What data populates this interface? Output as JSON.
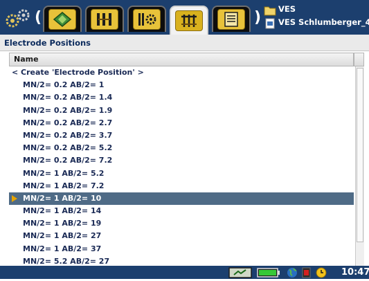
{
  "toolbar": {
    "tabs": [
      {
        "name": "tab-layout",
        "icon": "layout-diamond-icon",
        "active": false
      },
      {
        "name": "tab-electrodes",
        "icon": "electrode-array-icon",
        "active": false
      },
      {
        "name": "tab-settings",
        "icon": "electrode-gear-icon",
        "active": false
      },
      {
        "name": "tab-positions",
        "icon": "electrode-position-icon",
        "active": true
      },
      {
        "name": "tab-notes",
        "icon": "notepad-icon",
        "active": false
      }
    ],
    "breadcrumb": {
      "folder": "VES",
      "file": "VES Schlumberger_4"
    }
  },
  "section": {
    "title": "Electrode Positions"
  },
  "list": {
    "column_header": "Name",
    "create_item": "< Create 'Electrode Position' >",
    "items": [
      {
        "label": "MN/2= 0.2 AB/2= 1",
        "selected": false
      },
      {
        "label": "MN/2= 0.2 AB/2= 1.4",
        "selected": false
      },
      {
        "label": "MN/2= 0.2 AB/2= 1.9",
        "selected": false
      },
      {
        "label": "MN/2= 0.2 AB/2= 2.7",
        "selected": false
      },
      {
        "label": "MN/2= 0.2 AB/2= 3.7",
        "selected": false
      },
      {
        "label": "MN/2= 0.2 AB/2= 5.2",
        "selected": false
      },
      {
        "label": "MN/2= 0.2 AB/2= 7.2",
        "selected": false
      },
      {
        "label": "MN/2= 1 AB/2= 5.2",
        "selected": false
      },
      {
        "label": "MN/2= 1 AB/2= 7.2",
        "selected": false
      },
      {
        "label": "MN/2= 1 AB/2= 10",
        "selected": true
      },
      {
        "label": "MN/2= 1 AB/2= 14",
        "selected": false
      },
      {
        "label": "MN/2= 1 AB/2= 19",
        "selected": false
      },
      {
        "label": "MN/2= 1 AB/2= 27",
        "selected": false
      },
      {
        "label": "MN/2= 1 AB/2= 37",
        "selected": false
      },
      {
        "label": "MN/2= 5.2 AB/2= 27",
        "selected": false
      }
    ]
  },
  "statusbar": {
    "clock": "10:47",
    "icons": [
      "instrument-icon",
      "battery-icon",
      "globe-icon",
      "record-icon",
      "clock-icon"
    ]
  },
  "colors": {
    "toolbar_bg": "#1c3f6e",
    "selected_row": "#4f6b86",
    "tab_icon": "#e8c23a"
  }
}
